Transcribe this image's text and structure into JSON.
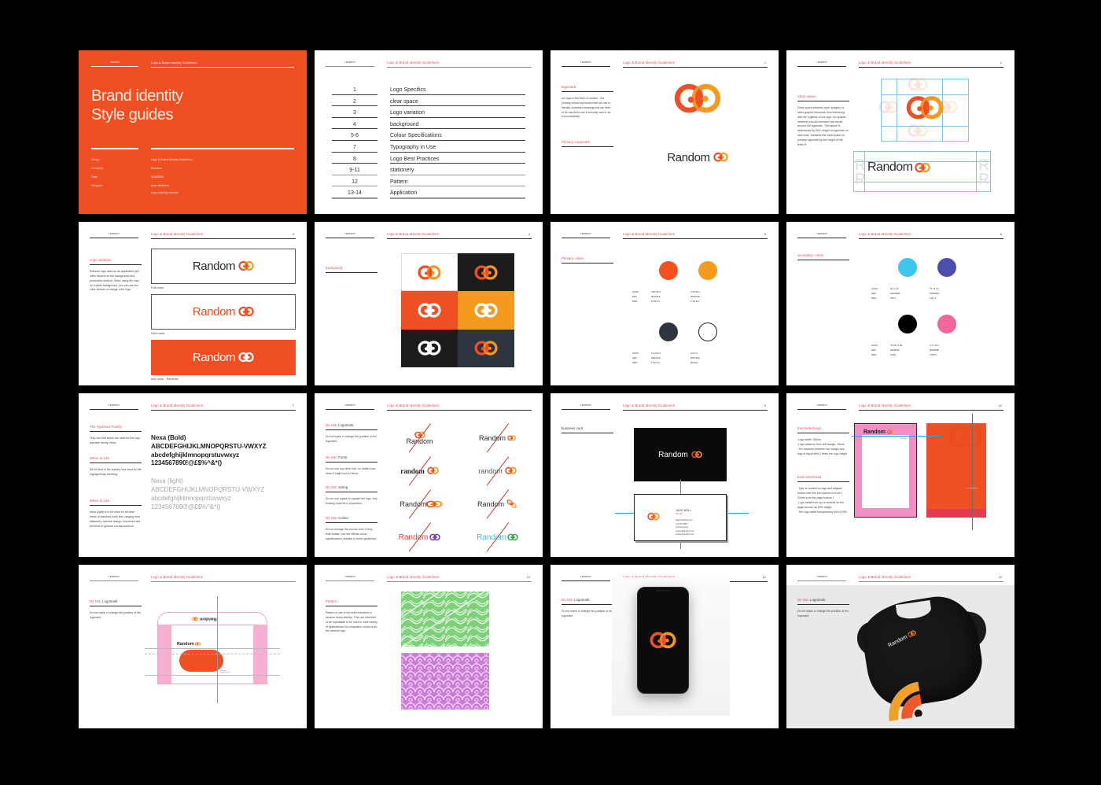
{
  "brand": {
    "name": "random",
    "doc_title": "Logo & Brand Identity Guidelines",
    "wordmark": "Random",
    "colors": {
      "orange_red": "#F04E23",
      "amber": "#F59A1E",
      "dark_navy": "#2E3440",
      "white": "#FFFFFF",
      "cyan": "#3EC6EC",
      "indigo": "#4D4FAF",
      "black": "#000000",
      "pink": "#F2689B",
      "accent_red_text": "#E0484D"
    }
  },
  "cover": {
    "brand": "random",
    "doc_title": "Logo & Brand Identity Guidelines",
    "title_line1": "Brand identity",
    "title_line2": "Style guides",
    "meta": [
      {
        "key": "Design",
        "value": "Logo & Brand Identity Guidelines"
      },
      {
        "key": "Company",
        "value": "Random"
      },
      {
        "key": "Date",
        "value": "11/5/2019"
      },
      {
        "key": "Designer",
        "value": "Alaa sheikhria",
        "value2": "Logo training channel"
      }
    ]
  },
  "toc": {
    "rows": [
      {
        "num": "1",
        "title": "Logo Specifics"
      },
      {
        "num": "2",
        "title": "clear space"
      },
      {
        "num": "3",
        "title": "Logo variation"
      },
      {
        "num": "4",
        "title": "background"
      },
      {
        "num": "5-6",
        "title": "Colour Specifications"
      },
      {
        "num": "7",
        "title": "Typography in Use"
      },
      {
        "num": "8",
        "title": "Logo Best Practices"
      },
      {
        "num": "9-11",
        "title": "stationery"
      },
      {
        "num": "12",
        "title": "Pattern"
      },
      {
        "num": "13-14",
        "title": "Application"
      }
    ]
  },
  "slides": {
    "logomark": {
      "page": "1",
      "heading": "logomark",
      "body": "our logo is the face of random - the primary visual expression that we use to identify ourselves meaning that we need to be careful to use it correctly and to do so consistently.",
      "subheading": "Primary Logomark"
    },
    "clear_space": {
      "page": "2",
      "heading": "Clear space",
      "body": "Clear space prevents type, imagery or other graphic elements from interfering with the legibility of our logo. No graphic elements should encroach the border around the logomark. This space is determined by 50% height of logomark on each side. Measure the clear space for primary logomark by the height of the letter R."
    },
    "logo_variation": {
      "page": "3",
      "heading": "Logo variation",
      "body": "Random logo used on an application will often depend on the background and production method. When using the logo on a white background, you can use full color version or orange color logo.",
      "captions": [
        "Full color",
        "One color",
        "one color : Reverse"
      ]
    },
    "background": {
      "page": "4",
      "heading": "backgound",
      "swatches": [
        "#FFFFFF",
        "#1C1C1C",
        "#F04E23",
        "#F59A1E",
        "#1C1C1C",
        "#2E3440"
      ]
    },
    "primary_colors": {
      "page": "5",
      "heading": "Primary colors",
      "labels": [
        "CMYK",
        "HEX",
        "PMS"
      ],
      "items": [
        {
          "color": "#F4511E",
          "cmyk": "0  80  90  0",
          "hex": "#F4511E",
          "pms": "P 48-8 C"
        },
        {
          "color": "#F59A1E",
          "cmyk": "0  45  90  0",
          "hex": "#F59A1E",
          "pms": "P 19-8 C"
        },
        {
          "color": "#2E3440",
          "cmyk": "0  34  52  0",
          "hex": "#2E3440",
          "pms": "P 60-5 C"
        },
        {
          "color": "#FFFFFF",
          "cmyk": "0  0  0  0",
          "hex": "#FFFFFF",
          "pms": "BLANC"
        }
      ]
    },
    "secondary_colors": {
      "page": "6",
      "heading": "secondary colors",
      "labels": [
        "CMYK",
        "HEX",
        "PMS"
      ],
      "items": [
        {
          "color": "#3EC6EC",
          "cmyk": "62  4  4  0",
          "hex": "#40C6EB",
          "pms": "299 C"
        },
        {
          "color": "#4D4FAF",
          "cmyk": "75  74  4  0",
          "hex": "#4D50AA",
          "pms": "2111 C"
        },
        {
          "color": "#000000",
          "cmyk": "75  64  67  90",
          "hex": "#000000",
          "pms": "NOIR"
        },
        {
          "color": "#F2689B",
          "cmyk": "0  71  12  0",
          "hex": "#F2689B",
          "pms": "1785 C"
        }
      ]
    },
    "typography": {
      "page": "7",
      "blocks": [
        {
          "heading": "The Typeface Family",
          "body": "Only one font styles are used for the logo, typeface family: Nexa"
        },
        {
          "heading": "When to Use",
          "body": "NEXA Bold is the primary font used for the logotype/logo wordting."
        },
        {
          "heading": "When to Use",
          "body": "Nexa (light) is to be used for all other forms of standard body text, ranging from stationery, website design, brochures and all forms of general correspondence."
        }
      ],
      "specimen_bold": {
        "name": "Nexa (Bold)",
        "upper": "ABCDEFGHIJKLMNOPQRSTU-VWXYZ",
        "lower": "abcdefghijklmnopqrstuvwxyz",
        "digits": "1234567890!@£$%^&*()"
      },
      "specimen_light": {
        "name": "Nexa (light)",
        "upper": "ABCDEFGHIJKLMNOPQRSTU-VWXYZ",
        "lower": "abcdefghijklmnopqrstuvwxyz",
        "digits": "1234567890!@£$%^&*()"
      }
    },
    "do_not": {
      "page": "8",
      "blocks": [
        {
          "heading_red": "Do Not:",
          "heading": "Logomark",
          "body": "Do not make or change the position of the logomark."
        },
        {
          "heading_red": "Do Not:",
          "heading": "Fonts",
          "body": "Do not  use any other font, no matter how close it might look to Nexa."
        },
        {
          "heading_red": "Do Not:",
          "heading": "Sizing",
          "body": "Do not  use squish or squash the logo. Any resizing must be in proportion."
        },
        {
          "heading_red": "Do Not:",
          "heading": "Colour",
          "body": "Do not change the colours even if they look similar. Use the official colour specifications detailed in these guidelines."
        }
      ]
    },
    "business_card": {
      "page": "9",
      "heading": "business card",
      "contact_name": "JACK WELL",
      "contact_role": "Founder",
      "contact_lines": [
        "www.randomco.com",
        "+61 575 4548",
        "victoria street 5",
        "sydney@random.com",
        "sydney@random.com"
      ]
    },
    "letterhead": {
      "page": "10",
      "blocks": [
        {
          "heading": "front letterhead",
          "body": "-Logo width: 55mm\n-Logo distance from left margin: 20mm\n-The distance between top margin and logo is equal with 2 times the logo height"
        },
        {
          "heading": "back letterhead",
          "body": "-Type is centred on logo and aligned bottom with the info placed on front ( 20mm from the page bottom )\n-Logo detail from top is centred on the page and set as 50% height\n-The logo detail transparency set to 20%"
        }
      ],
      "letter_word": "Random"
    },
    "envelope": {
      "page": "11",
      "heading_red": "Do Not:",
      "heading": "Logomark",
      "body": "Do not make or change the position of the logomark.",
      "word": "Random"
    },
    "pattern": {
      "page": "12",
      "heading": "Pattern",
      "body": "Pattern is one of the main elements in random brand identity. They are intended to be repeatable to be used in wide variety of applications.Our inspiration comes from the random logo",
      "swatch_a": "#7ED07B",
      "swatch_b": "#C97BD6"
    },
    "phone": {
      "page": "12",
      "heading_red": "Do Not:",
      "heading": "Logomark",
      "body": "Do not make or change the position of the logomark."
    },
    "tshirt": {
      "page": "13",
      "heading_red": "Do Not:",
      "heading": "Logomark",
      "body": "Do not make or change the position of the logomark.",
      "word": "Random"
    }
  }
}
